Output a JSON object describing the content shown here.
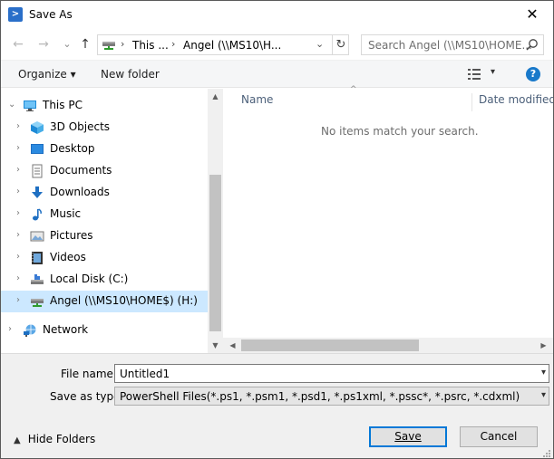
{
  "window": {
    "title": "Save As",
    "app_icon": "powershell-icon",
    "close_glyph": "✕"
  },
  "nav": {
    "back": "←",
    "forward": "→",
    "recent": "⌄",
    "up": "↑"
  },
  "address": {
    "segments": [
      "This ...",
      "Angel (\\\\MS10\\H..."
    ],
    "separator": "›",
    "dropdown": "⌄",
    "refresh": "↻"
  },
  "search": {
    "placeholder": "Search Angel (\\\\MS10\\HOME..."
  },
  "commandbar": {
    "organize": "Organize ▾",
    "new_folder": "New folder",
    "view_dd": "▾",
    "help": "?"
  },
  "tree": [
    {
      "label": "This PC",
      "icon": "this-pc-icon",
      "level": 0,
      "expanded": true
    },
    {
      "label": "3D Objects",
      "icon": "3d-objects-icon",
      "level": 1
    },
    {
      "label": "Desktop",
      "icon": "desktop-icon",
      "level": 1
    },
    {
      "label": "Documents",
      "icon": "documents-icon",
      "level": 1
    },
    {
      "label": "Downloads",
      "icon": "downloads-icon",
      "level": 1
    },
    {
      "label": "Music",
      "icon": "music-icon",
      "level": 1
    },
    {
      "label": "Pictures",
      "icon": "pictures-icon",
      "level": 1
    },
    {
      "label": "Videos",
      "icon": "videos-icon",
      "level": 1
    },
    {
      "label": "Local Disk (C:)",
      "icon": "local-disk-icon",
      "level": 1
    },
    {
      "label": "Angel (\\\\MS10\\HOME$) (H:)",
      "icon": "network-drive-icon",
      "level": 1,
      "selected": true
    },
    {
      "label": "Network",
      "icon": "network-icon",
      "level": 0
    }
  ],
  "filelist": {
    "columns": {
      "name": "Name",
      "date_modified": "Date modified"
    },
    "sort_glyph": "^",
    "empty_message": "No items match your search."
  },
  "form": {
    "file_name_label": "File name:",
    "file_name_value": "Untitled1",
    "save_as_type_label": "Save as type:",
    "save_as_type_value": "PowerShell Files(*.ps1, *.psm1, *.psd1, *.ps1xml, *.pssc*, *.psrc, *.cdxml)"
  },
  "footer": {
    "hide_folders": "Hide Folders",
    "save_button": "Save",
    "cancel_button": "Cancel"
  },
  "colors": {
    "selected_row": "#cce8ff",
    "accent": "#0078d7",
    "help": "#1979ca"
  }
}
